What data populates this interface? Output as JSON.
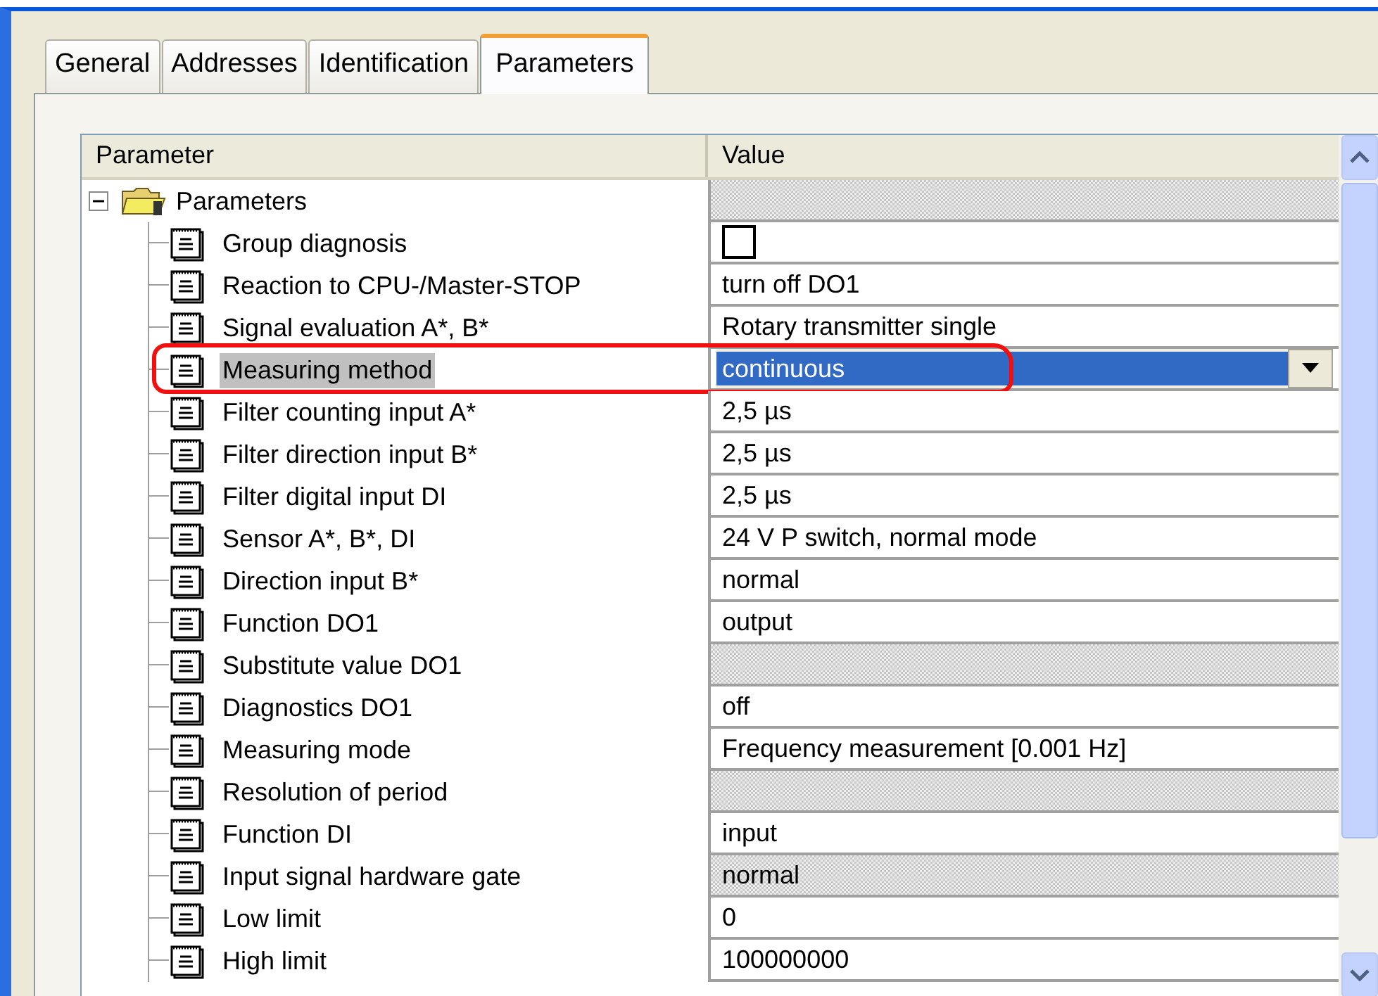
{
  "tabs": [
    {
      "label": "General",
      "selected": false
    },
    {
      "label": "Addresses",
      "selected": false
    },
    {
      "label": "Identification",
      "selected": false
    },
    {
      "label": "Parameters",
      "selected": true
    }
  ],
  "table": {
    "columns": [
      "Parameter",
      "Value"
    ],
    "root": {
      "label": "Parameters",
      "expanded": true,
      "disabled": true,
      "children": [
        {
          "label": "Group diagnosis",
          "kind": "checkbox",
          "checked": false,
          "disabled": false,
          "selected": false,
          "annotated": false
        },
        {
          "label": "Reaction to CPU-/Master-STOP",
          "kind": "text",
          "value": "turn off DO1",
          "disabled": false,
          "selected": false,
          "annotated": false
        },
        {
          "label": "Signal evaluation A*, B*",
          "kind": "text",
          "value": "Rotary transmitter single",
          "disabled": false,
          "selected": false,
          "annotated": false
        },
        {
          "label": "Measuring method",
          "kind": "dropdown",
          "value": "continuous",
          "disabled": false,
          "selected": true,
          "annotated": true
        },
        {
          "label": "Filter counting input A*",
          "kind": "text",
          "value": "2,5 µs",
          "disabled": false,
          "selected": false,
          "annotated": false
        },
        {
          "label": "Filter direction input B*",
          "kind": "text",
          "value": "2,5 µs",
          "disabled": false,
          "selected": false,
          "annotated": false
        },
        {
          "label": "Filter digital input DI",
          "kind": "text",
          "value": "2,5 µs",
          "disabled": false,
          "selected": false,
          "annotated": false
        },
        {
          "label": "Sensor A*, B*, DI",
          "kind": "text",
          "value": "24 V P switch, normal mode",
          "disabled": false,
          "selected": false,
          "annotated": false
        },
        {
          "label": "Direction input B*",
          "kind": "text",
          "value": "normal",
          "disabled": false,
          "selected": false,
          "annotated": false
        },
        {
          "label": "Function DO1",
          "kind": "text",
          "value": "output",
          "disabled": false,
          "selected": false,
          "annotated": false
        },
        {
          "label": "Substitute value DO1",
          "kind": "text",
          "disabled": true,
          "selected": false,
          "annotated": false
        },
        {
          "label": "Diagnostics DO1",
          "kind": "text",
          "value": "off",
          "disabled": false,
          "selected": false,
          "annotated": false
        },
        {
          "label": "Measuring mode",
          "kind": "text",
          "value": "Frequency measurement [0.001 Hz]",
          "disabled": false,
          "selected": false,
          "annotated": false
        },
        {
          "label": "Resolution of period",
          "kind": "text",
          "disabled": true,
          "selected": false,
          "annotated": false
        },
        {
          "label": "Function DI",
          "kind": "text",
          "value": "input",
          "disabled": false,
          "selected": false,
          "annotated": false
        },
        {
          "label": "Input signal hardware gate",
          "kind": "text",
          "value": "normal",
          "disabled": true,
          "selected": false,
          "annotated": false
        },
        {
          "label": "Low limit",
          "kind": "text",
          "value": "0",
          "disabled": false,
          "selected": false,
          "annotated": false
        },
        {
          "label": "High limit",
          "kind": "text",
          "value": "100000000",
          "disabled": false,
          "selected": false,
          "annotated": false
        }
      ]
    }
  }
}
